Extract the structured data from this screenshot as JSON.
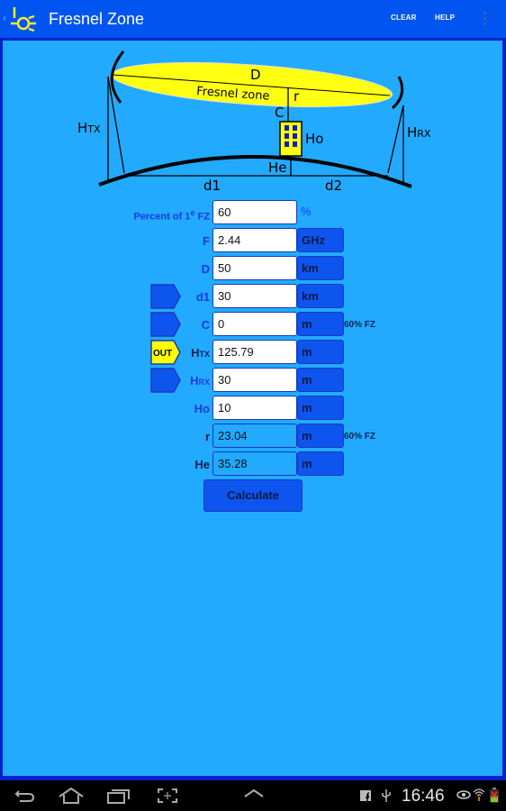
{
  "app": {
    "title": "Fresnel Zone",
    "actions": {
      "clear": "CLEAR",
      "help": "HELP"
    },
    "icons": {
      "back": "back-caret-icon",
      "logo": "antenna-logo-icon",
      "overflow": "overflow-menu-icon"
    }
  },
  "diagram": {
    "labels": {
      "D": "D",
      "fresnel": "Fresnel zone",
      "r": "r",
      "C": "C",
      "htx": "H",
      "htx_sub": "TX",
      "hrx": "H",
      "hrx_sub": "RX",
      "ho": "Ho",
      "he": "He",
      "d1": "d1",
      "d2": "d2"
    }
  },
  "form": {
    "rows": [
      {
        "id": "percent",
        "label": "Percent of 1",
        "label_sup": "e",
        "label_tail": " FZ",
        "value": "60",
        "unit": "%",
        "note": "",
        "tag": ""
      },
      {
        "id": "f",
        "label": "F",
        "value": "2.44",
        "unit": "GHz",
        "note": "",
        "tag": ""
      },
      {
        "id": "d",
        "label": "D",
        "value": "50",
        "unit": "km",
        "note": "",
        "tag": ""
      },
      {
        "id": "d1",
        "label": "d1",
        "value": "30",
        "unit": "km",
        "note": "",
        "tag": "in"
      },
      {
        "id": "c",
        "label": "C",
        "value": "0",
        "unit": "m",
        "note": "60% FZ",
        "tag": "in"
      },
      {
        "id": "htx",
        "label": "H",
        "label_sub": "TX",
        "value": "125.79",
        "unit": "m",
        "note": "",
        "tag": "OUT"
      },
      {
        "id": "hrx",
        "label": "H",
        "label_sub": "RX",
        "value": "30",
        "unit": "m",
        "note": "",
        "tag": "in"
      },
      {
        "id": "ho",
        "label": "Ho",
        "value": "10",
        "unit": "m",
        "note": "",
        "tag": ""
      },
      {
        "id": "r",
        "label": "r",
        "value": "23.04",
        "unit": "m",
        "note": "60% FZ",
        "tag": ""
      },
      {
        "id": "he",
        "label": "He",
        "value": "35.28",
        "unit": "m",
        "note": "",
        "tag": ""
      }
    ],
    "calculate": "Calculate",
    "colors": {
      "out_tag": "#ffff00",
      "in_tag": "#0e55f0",
      "unit_bg": "#0e55f0",
      "background": "#22aaff"
    }
  },
  "statusbar": {
    "time": "16:46",
    "icons": [
      "back-icon",
      "home-icon",
      "recent-apps-icon",
      "screenshot-icon",
      "up-caret-icon",
      "facebook-icon",
      "usb-icon",
      "eye-icon",
      "wifi-icon",
      "battery-icon"
    ]
  }
}
